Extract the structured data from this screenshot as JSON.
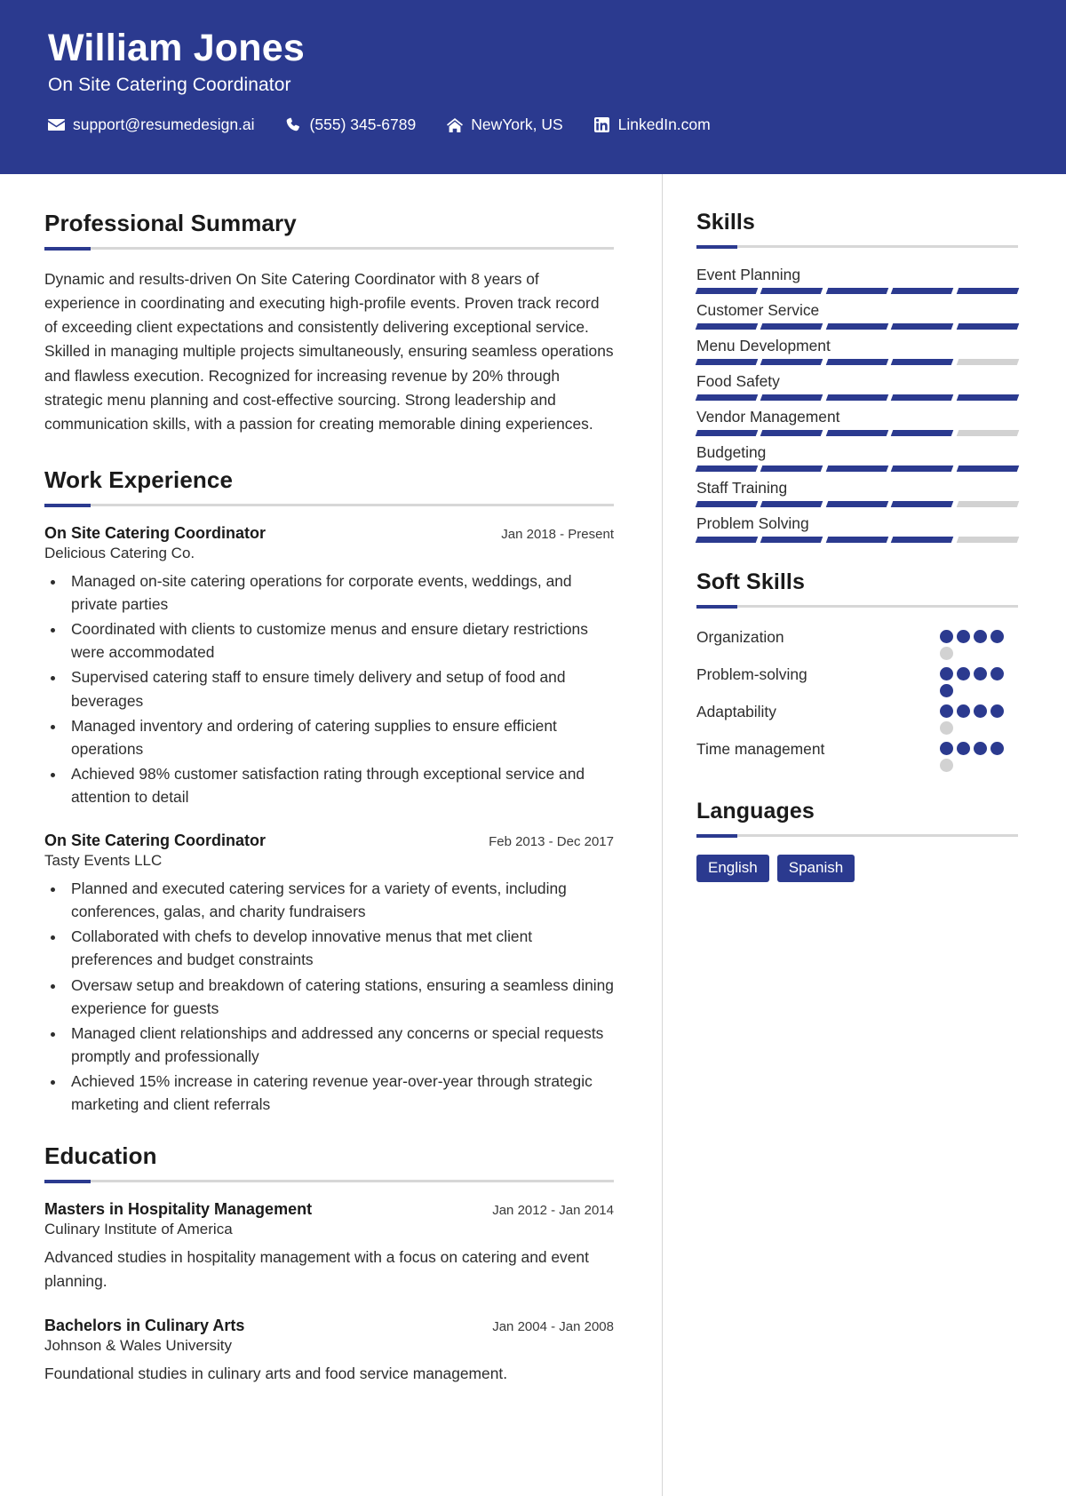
{
  "theme": {
    "accent": "#2b3a8f",
    "muted_bar": "#d2d2d2",
    "header_text": "#ffffff"
  },
  "header": {
    "name": "William Jones",
    "role": "On Site Catering Coordinator",
    "contacts": [
      {
        "icon": "envelope-icon",
        "text": "support@resumedesign.ai"
      },
      {
        "icon": "phone-icon",
        "text": "(555) 345-6789"
      },
      {
        "icon": "home-icon",
        "text": "NewYork, US"
      },
      {
        "icon": "linkedin-icon",
        "text": "LinkedIn.com"
      }
    ]
  },
  "main": {
    "summary": {
      "title": "Professional Summary",
      "text": "Dynamic and results-driven On Site Catering Coordinator with 8 years of experience in coordinating and executing high-profile events. Proven track record of exceeding client expectations and consistently delivering exceptional service. Skilled in managing multiple projects simultaneously, ensuring seamless operations and flawless execution. Recognized for increasing revenue by 20% through strategic menu planning and cost-effective sourcing. Strong leadership and communication skills, with a passion for creating memorable dining experiences."
    },
    "work": {
      "title": "Work Experience",
      "entries": [
        {
          "title": "On Site Catering Coordinator",
          "date": "Jan 2018 - Present",
          "org": "Delicious Catering Co.",
          "bullets": [
            "Managed on-site catering operations for corporate events, weddings, and private parties",
            "Coordinated with clients to customize menus and ensure dietary restrictions were accommodated",
            "Supervised catering staff to ensure timely delivery and setup of food and beverages",
            "Managed inventory and ordering of catering supplies to ensure efficient operations",
            "Achieved 98% customer satisfaction rating through exceptional service and attention to detail"
          ]
        },
        {
          "title": "On Site Catering Coordinator",
          "date": "Feb 2013 - Dec 2017",
          "org": "Tasty Events LLC",
          "bullets": [
            "Planned and executed catering services for a variety of events, including conferences, galas, and charity fundraisers",
            "Collaborated with chefs to develop innovative menus that met client preferences and budget constraints",
            "Oversaw setup and breakdown of catering stations, ensuring a seamless dining experience for guests",
            "Managed client relationships and addressed any concerns or special requests promptly and professionally",
            "Achieved 15% increase in catering revenue year-over-year through strategic marketing and client referrals"
          ]
        }
      ]
    },
    "education": {
      "title": "Education",
      "entries": [
        {
          "title": "Masters in Hospitality Management",
          "date": "Jan 2012 - Jan 2014",
          "org": "Culinary Institute of America",
          "desc": "Advanced studies in hospitality management with a focus on catering and event planning."
        },
        {
          "title": "Bachelors in Culinary Arts",
          "date": "Jan 2004 - Jan 2008",
          "org": "Johnson & Wales University",
          "desc": "Foundational studies in culinary arts and food service management."
        }
      ]
    }
  },
  "sidebar": {
    "skills": {
      "title": "Skills",
      "segments_total": 5,
      "items": [
        {
          "label": "Event Planning",
          "filled": 5
        },
        {
          "label": "Customer Service",
          "filled": 5
        },
        {
          "label": "Menu Development",
          "filled": 4
        },
        {
          "label": "Food Safety",
          "filled": 5
        },
        {
          "label": "Vendor Management",
          "filled": 4
        },
        {
          "label": "Budgeting",
          "filled": 5
        },
        {
          "label": "Staff Training",
          "filled": 4
        },
        {
          "label": "Problem Solving",
          "filled": 4
        }
      ]
    },
    "soft_skills": {
      "title": "Soft Skills",
      "dots_total": 5,
      "items": [
        {
          "label": "Organization",
          "filled": 4
        },
        {
          "label": "Problem-solving",
          "filled": 5
        },
        {
          "label": "Adaptability",
          "filled": 4
        },
        {
          "label": "Time management",
          "filled": 4
        }
      ]
    },
    "languages": {
      "title": "Languages",
      "items": [
        "English",
        "Spanish"
      ]
    }
  }
}
